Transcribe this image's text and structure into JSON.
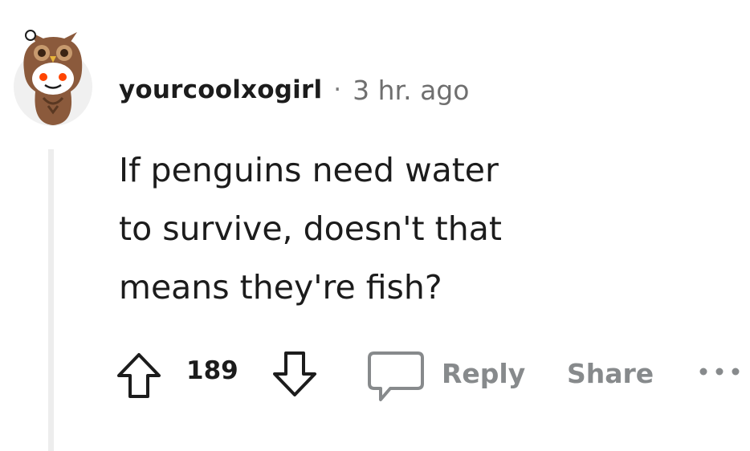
{
  "comment": {
    "author": "yourcoolxogirl",
    "separator": "·",
    "timestamp": "3 hr. ago",
    "body_lines": [
      "If penguins need water",
      "to survive, doesn't that",
      "means they're fish?"
    ]
  },
  "actions": {
    "score": "189",
    "reply_label": "Reply",
    "share_label": "Share"
  },
  "icons": {
    "avatar": "owl-costume-snoo-avatar",
    "upvote": "upvote-arrow-icon",
    "downvote": "downvote-arrow-icon",
    "comment": "comment-bubble-icon",
    "more": "more-options-icon"
  },
  "colors": {
    "text": "#1c1c1c",
    "meta": "#6f6f6f",
    "action_gray": "#878a8c",
    "thread_line": "#ededed",
    "avatar_bg": "#f0f0f0",
    "owl_brown": "#8b5a3c",
    "snoo_red_eye": "#ff4500"
  }
}
